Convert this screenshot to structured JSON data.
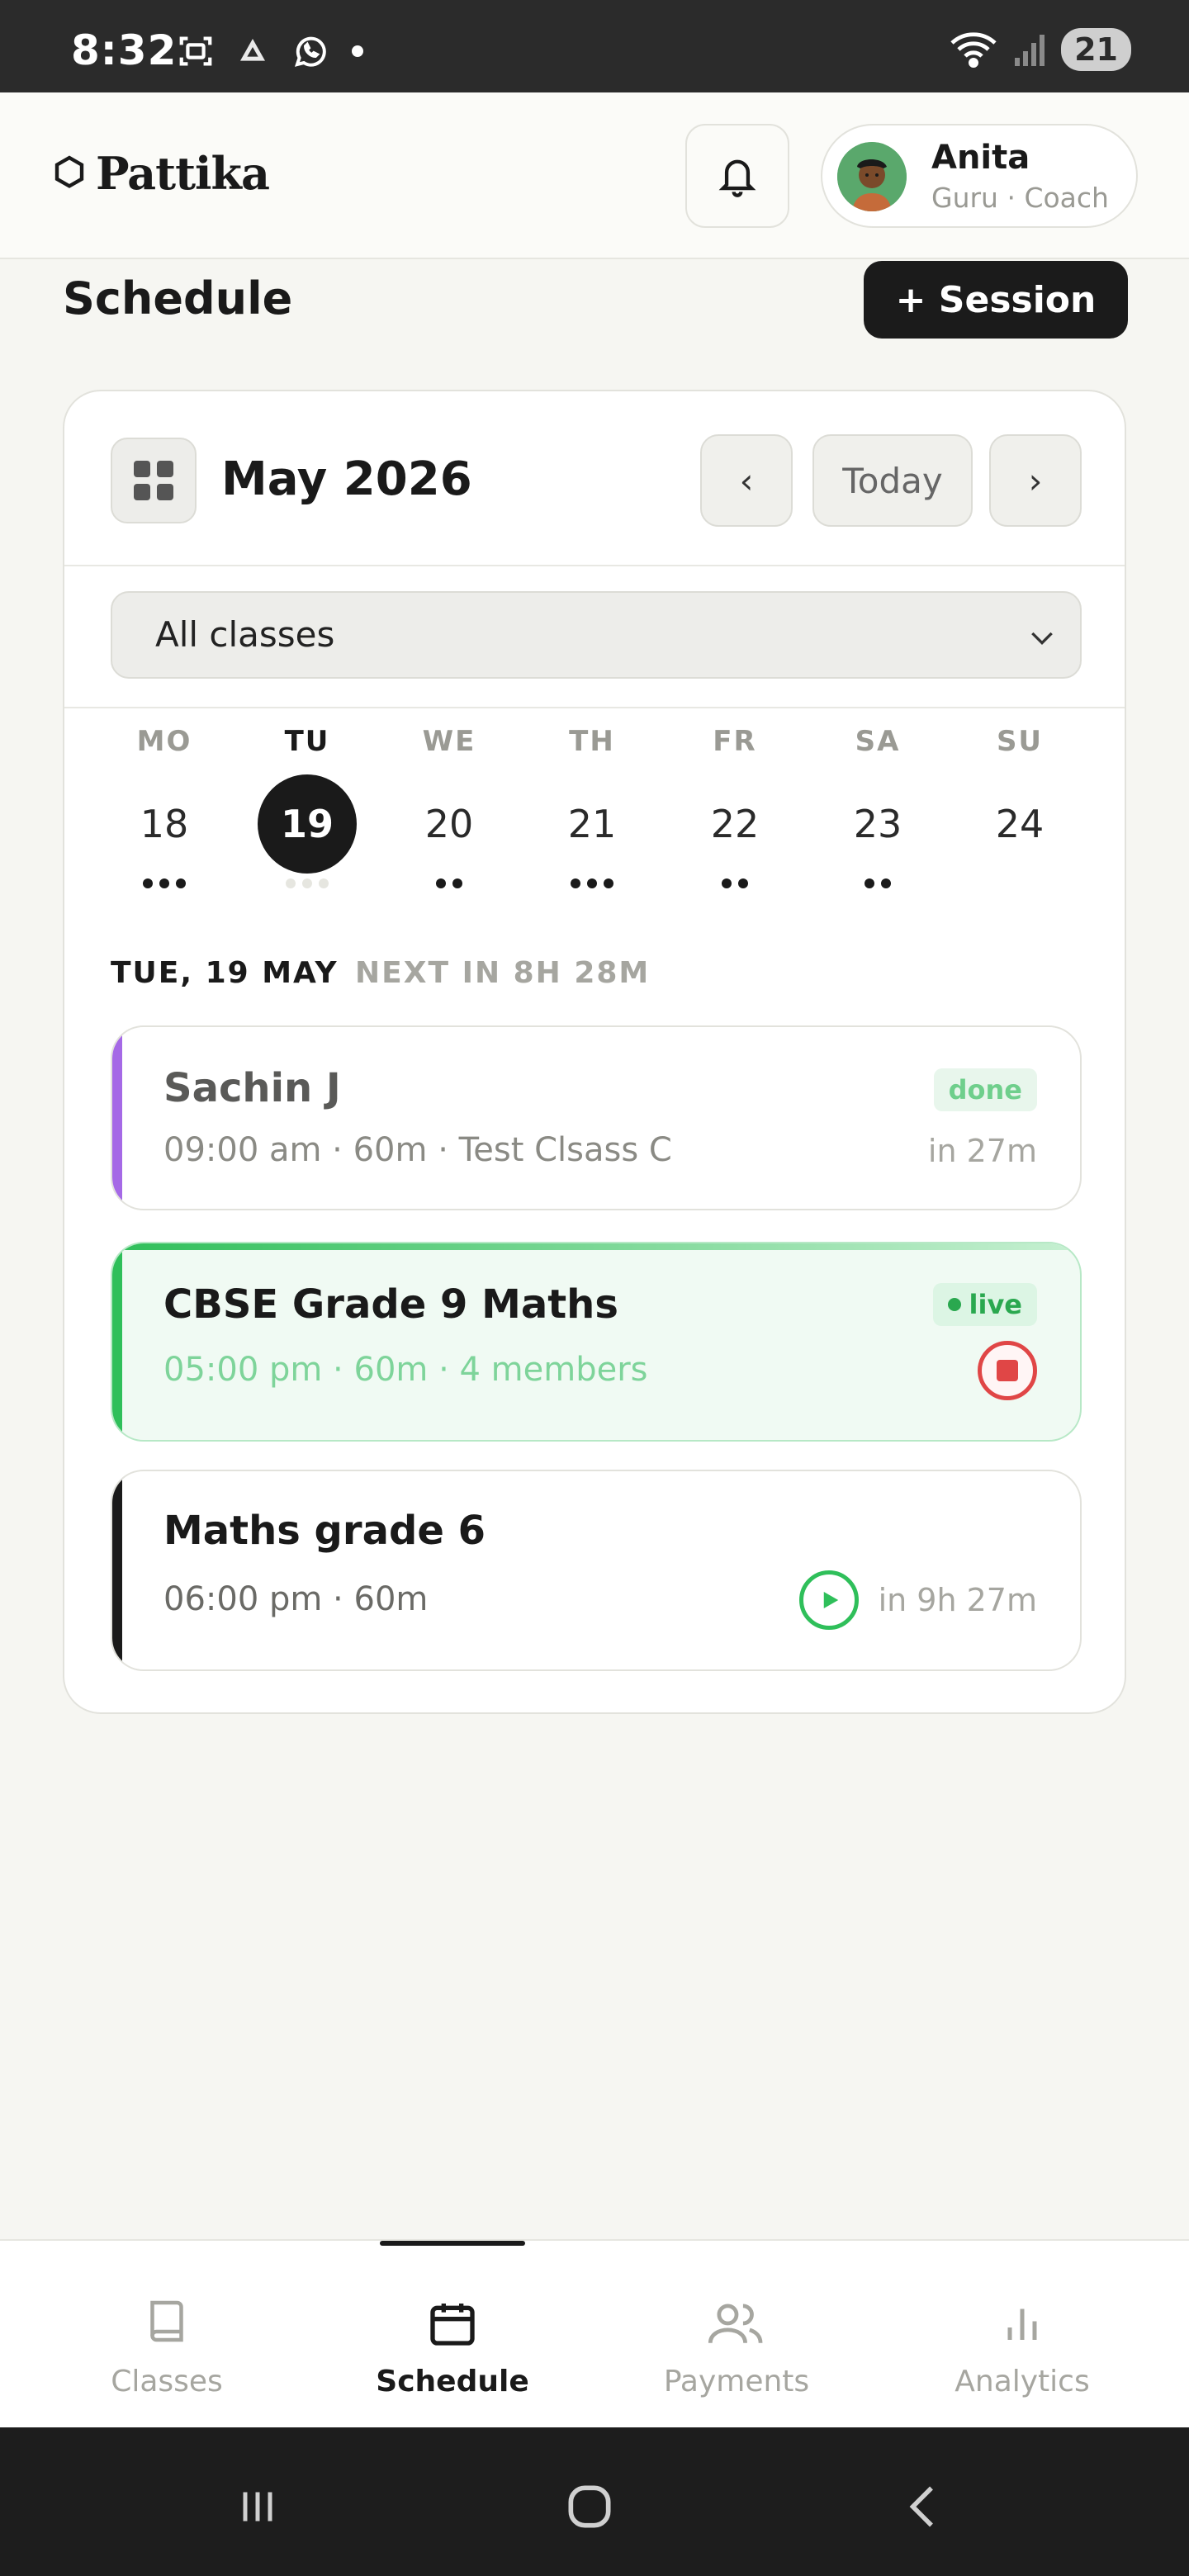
{
  "status_bar": {
    "time": "8:32",
    "battery": "21"
  },
  "header": {
    "logo": "Pattika",
    "user": {
      "name": "Anita",
      "role": "Guru · Coach"
    }
  },
  "page": {
    "title": "Schedule",
    "add_session_label": "+ Session"
  },
  "calendar": {
    "month_label": "May 2026",
    "prev_label": "‹",
    "today_label": "Today",
    "next_label": "›",
    "filter": {
      "selected": "All classes"
    },
    "week": [
      {
        "name": "MO",
        "num": "18",
        "dots": 3,
        "selected": false
      },
      {
        "name": "TU",
        "num": "19",
        "dots": 3,
        "selected": true
      },
      {
        "name": "WE",
        "num": "20",
        "dots": 2,
        "selected": false
      },
      {
        "name": "TH",
        "num": "21",
        "dots": 3,
        "selected": false
      },
      {
        "name": "FR",
        "num": "22",
        "dots": 2,
        "selected": false
      },
      {
        "name": "SA",
        "num": "23",
        "dots": 2,
        "selected": false
      },
      {
        "name": "SU",
        "num": "24",
        "dots": 0,
        "selected": false
      }
    ]
  },
  "agenda": {
    "date_heading": "TUE, 19 MAY",
    "next_in": "NEXT IN 8H 28M",
    "sessions": [
      {
        "title": "Sachin J",
        "meta": "09:00 am · 60m · Test Clsass C",
        "badge": "done",
        "right": "in 27m",
        "accent": "#a569e6"
      },
      {
        "title": "CBSE Grade 9 Maths",
        "meta": "05:00 pm · 60m · 4 members",
        "badge": "live",
        "accent": "#2fbf5a"
      },
      {
        "title": "Maths grade 6",
        "meta": "06:00 pm · 60m",
        "right": "in 9h 27m",
        "accent": "#1a1a1a"
      }
    ]
  },
  "bottom_nav": {
    "tabs": [
      {
        "label": "Classes",
        "icon": "book-icon",
        "active": false
      },
      {
        "label": "Schedule",
        "icon": "calendar-icon",
        "active": true
      },
      {
        "label": "Payments",
        "icon": "users-icon",
        "active": false
      },
      {
        "label": "Analytics",
        "icon": "bar-chart-icon",
        "active": false
      }
    ]
  }
}
